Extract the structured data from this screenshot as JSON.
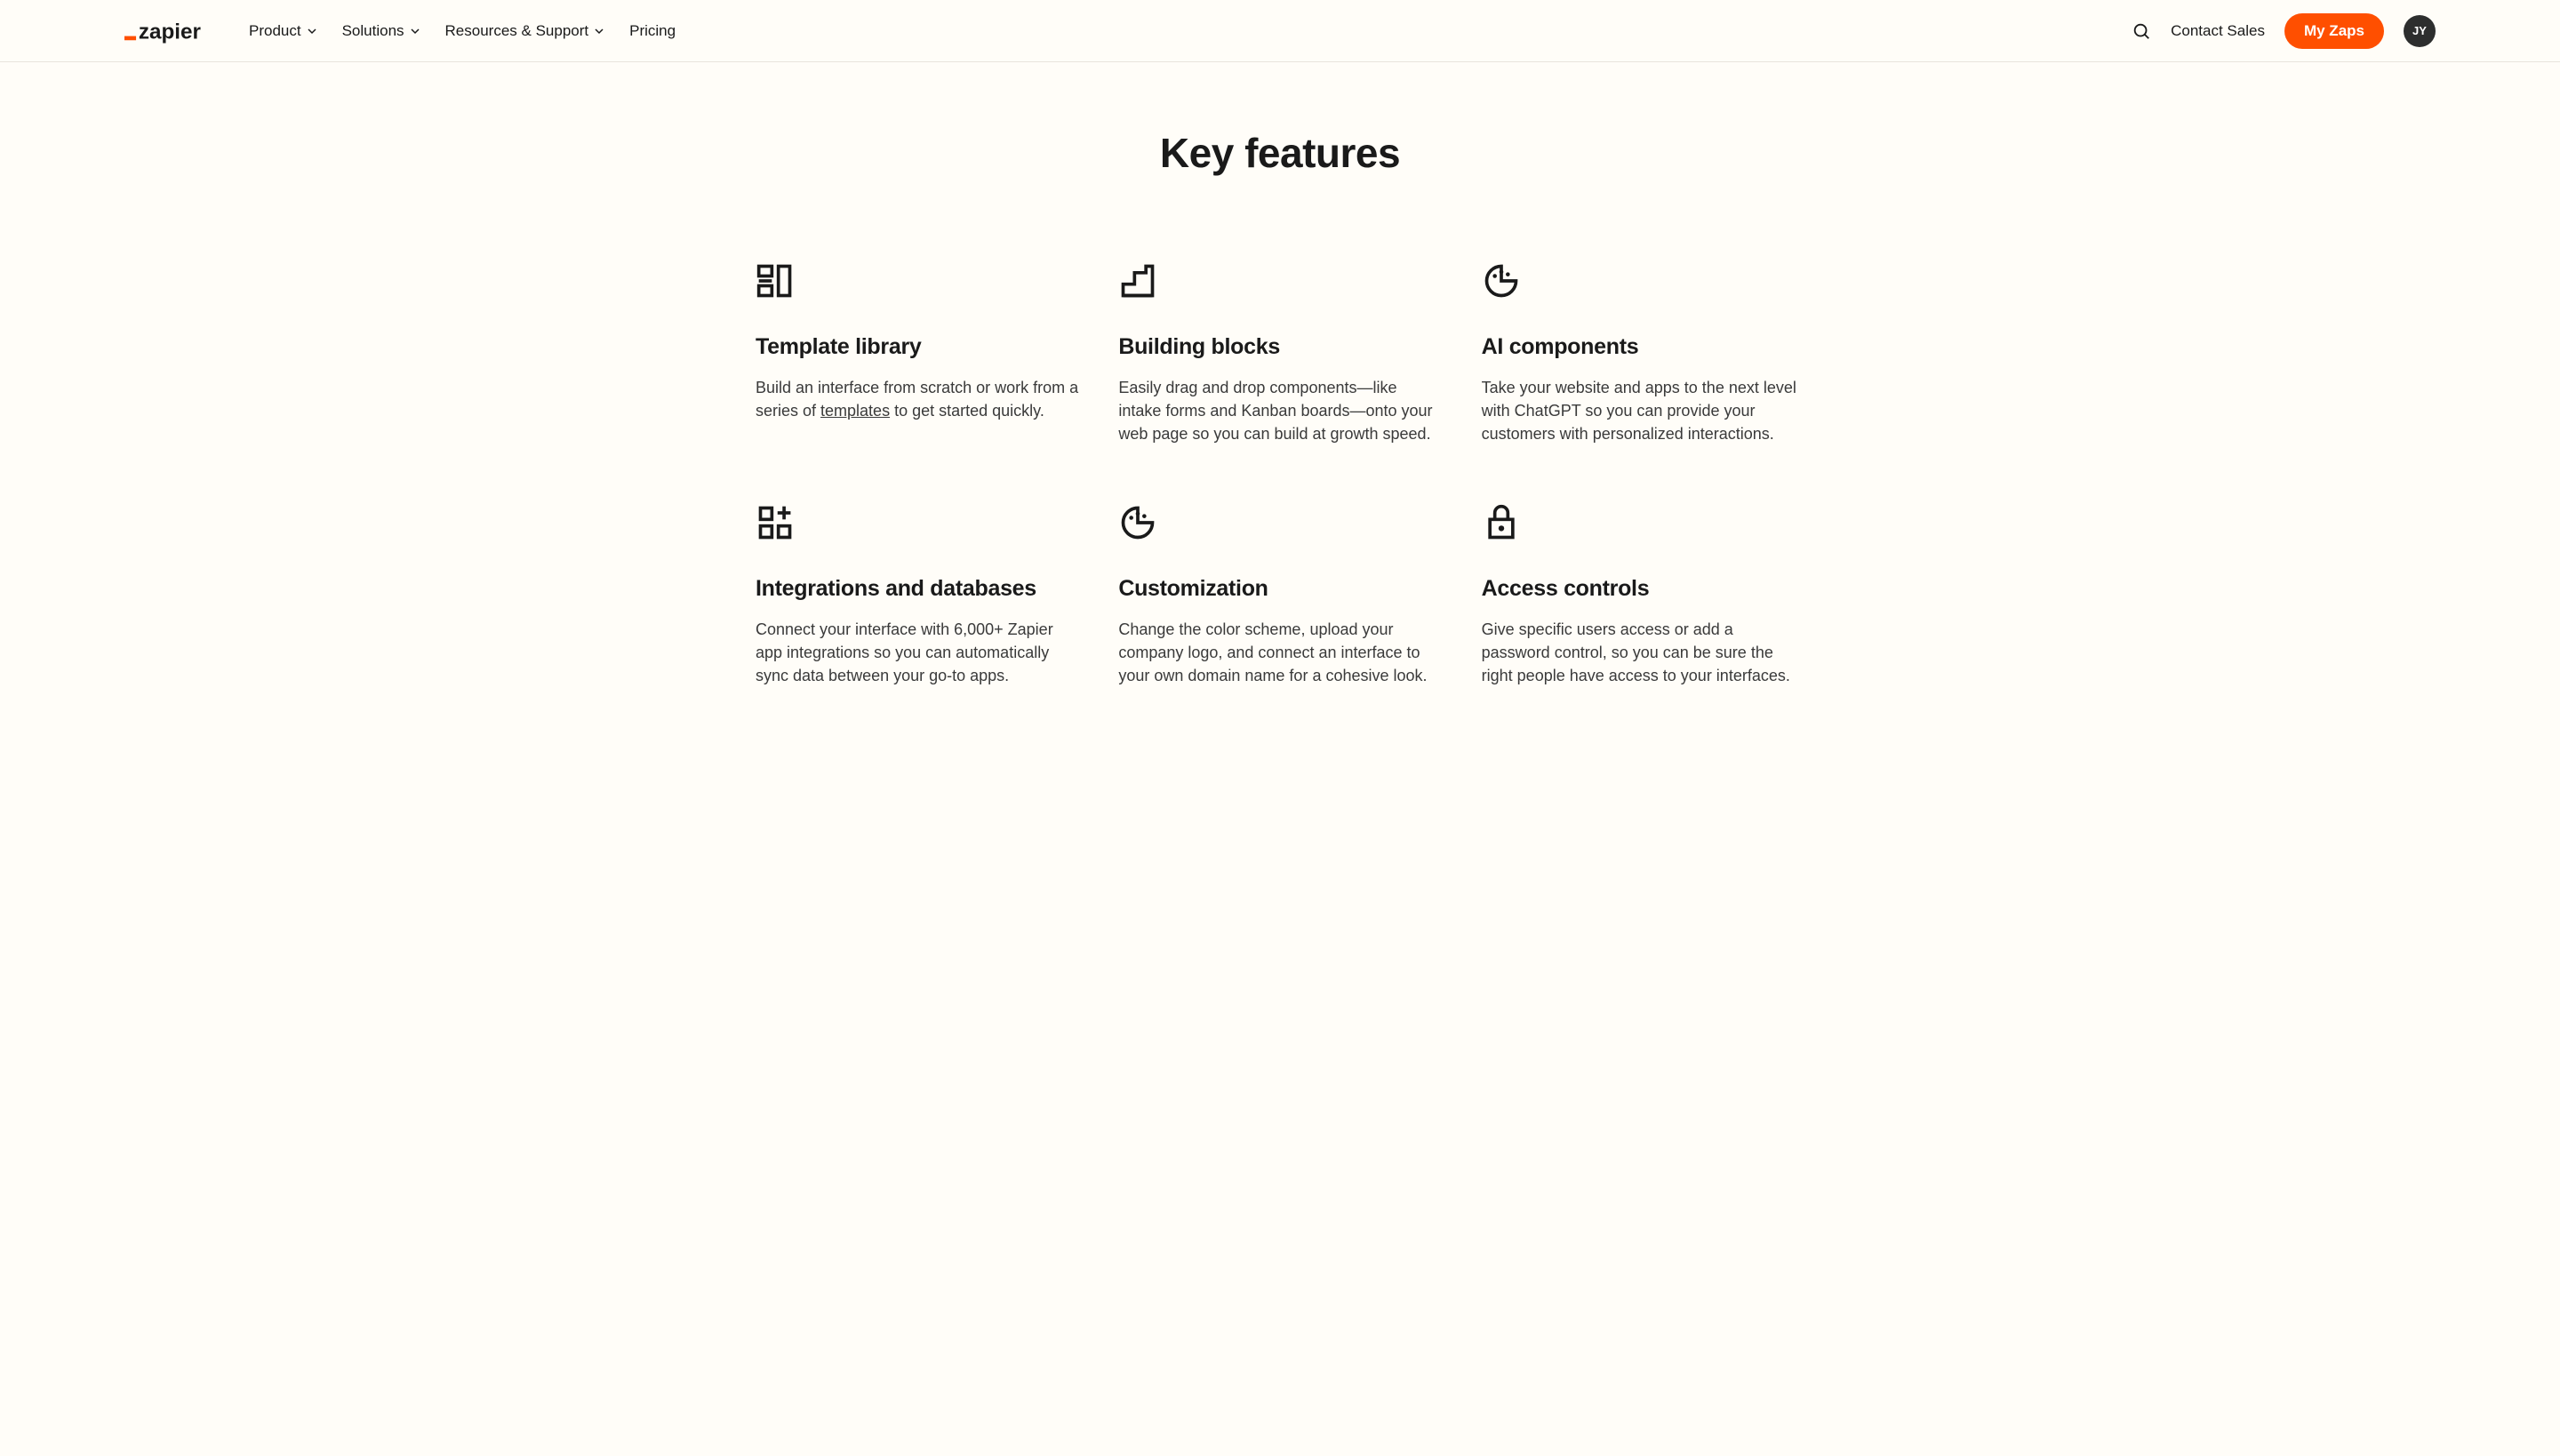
{
  "header": {
    "nav": {
      "product": "Product",
      "solutions": "Solutions",
      "resources": "Resources & Support",
      "pricing": "Pricing"
    },
    "contact": "Contact Sales",
    "my_zaps": "My Zaps",
    "avatar_initials": "JY"
  },
  "section": {
    "title": "Key features"
  },
  "features": {
    "template_library": {
      "title": "Template library",
      "desc_pre": "Build an interface from scratch or work from a series of ",
      "link_text": "templates",
      "desc_post": " to get started quickly."
    },
    "building_blocks": {
      "title": "Building blocks",
      "desc": "Easily drag and drop components—like intake forms and Kanban boards—onto your web page so you can build at growth speed."
    },
    "ai_components": {
      "title": "AI components",
      "desc": "Take your website and apps to the next level with ChatGPT so you can provide your customers with personalized interactions."
    },
    "integrations": {
      "title": "Integrations and databases",
      "desc": "Connect your interface with 6,000+ Zapier app integrations so you can automatically sync data between your go-to apps."
    },
    "customization": {
      "title": "Customization",
      "desc": "Change the color scheme, upload your company logo, and connect an interface to your own domain name for a cohesive look."
    },
    "access_controls": {
      "title": "Access controls",
      "desc": "Give specific users access or add a password control, so you can be sure the right people have access to your interfaces."
    }
  }
}
